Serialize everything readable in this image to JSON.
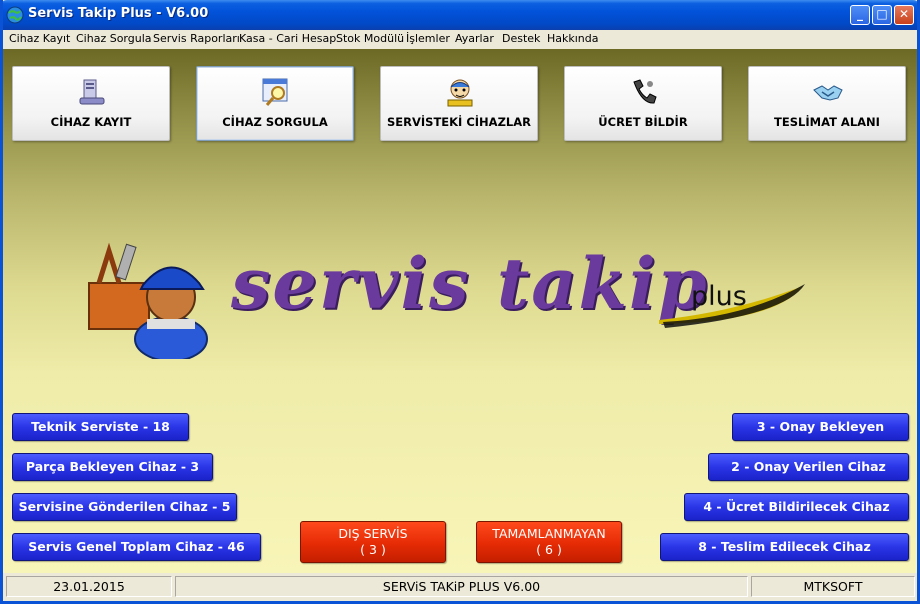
{
  "window": {
    "title": "Servis Takip Plus - V6.00"
  },
  "menu": [
    "Cihaz Kayıt",
    "Cihaz Sorgula",
    "Servis Raporları",
    "Kasa - Cari Hesap",
    "Stok Modülü",
    "İşlemler",
    "Ayarlar",
    "Destek",
    "Hakkında"
  ],
  "toolbar": {
    "cihaz_kayit": "CİHAZ KAYIT",
    "cihaz_sorgula": "CİHAZ SORGULA",
    "servisteki": "SERVİSTEKİ CİHAZLAR",
    "ucret_bildir": "ÜCRET BİLDİR",
    "teslimat": "TESLİMAT ALANI"
  },
  "logo": {
    "main": "servis takip",
    "plus": "plus"
  },
  "left_buttons": [
    "Teknik Serviste - 18",
    "Parça Bekleyen Cihaz - 3",
    "Servisine Gönderilen Cihaz - 5",
    "Servis Genel Toplam Cihaz - 46"
  ],
  "right_buttons": [
    "3 - Onay Bekleyen",
    "2 - Onay Verilen Cihaz",
    "4 - Ücret Bildirilecek Cihaz",
    "8 - Teslim Edilecek Cihaz"
  ],
  "center_buttons": {
    "dis_servis": {
      "label": "DIŞ SERVİS",
      "count": "( 3 )"
    },
    "tamamlanmayan": {
      "label": "TAMAMLANMAYAN",
      "count": "( 6 )"
    }
  },
  "status": {
    "date": "23.01.2015",
    "app": "SERViS TAKiP PLUS V6.00",
    "vendor": "MTKSOFT"
  },
  "colors": {
    "title_blue": "#0252d9",
    "button_blue": "#2a35e6",
    "button_red": "#e52b05",
    "logo_purple": "#6a3a9c"
  }
}
